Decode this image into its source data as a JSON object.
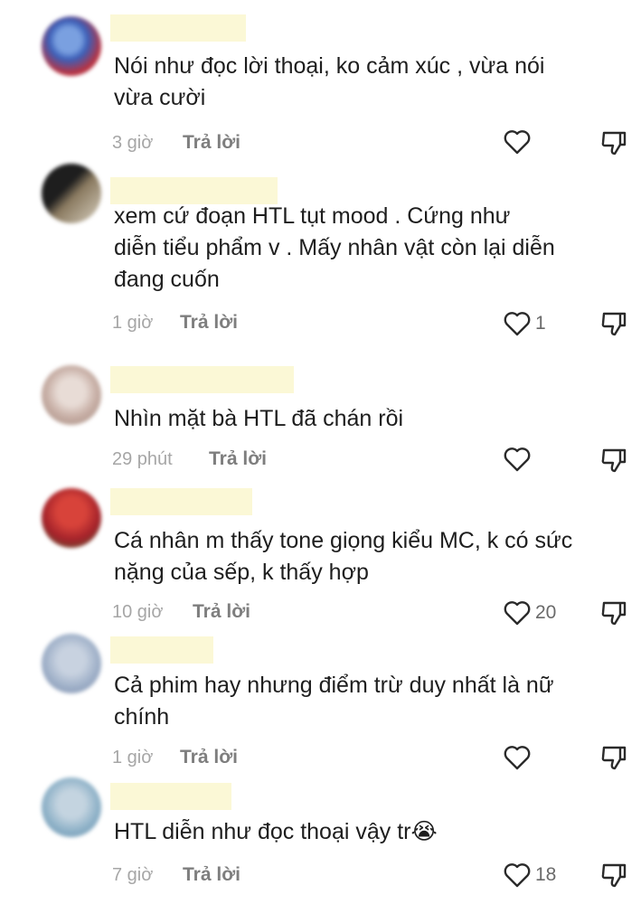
{
  "comments": [
    {
      "text": "Nói như đọc lời thoại, ko cảm xúc , vừa nói\nvừa cười",
      "time": "3 giờ",
      "reply": "Trả lời",
      "likes": "",
      "avatar_colors": [
        "#3b5fb8",
        "#c0303a",
        "#7aa0e0"
      ]
    },
    {
      "text": "  xem cứ đoạn HTL tụt mood      . Cứng như\ndiễn tiểu phẩm v . Mấy nhân vật còn lại diễn\nđang cuốn",
      "time": "1 giờ",
      "reply": "Trả lời",
      "likes": "1",
      "avatar_colors": [
        "#2a2a2a",
        "#8a7a60",
        "#d8d0c0"
      ]
    },
    {
      "text": "Nhìn mặt bà HTL đã chán rồi",
      "time": "29 phút",
      "reply": "Trả lời",
      "likes": "",
      "avatar_colors": [
        "#c9b1a8",
        "#e8dcd6",
        "#a08478"
      ]
    },
    {
      "text": "Cá nhân m thấy tone giọng kiểu MC, k có sức\nnặng của sếp, k thấy hợp",
      "time": "10 giờ",
      "reply": "Trả lời",
      "likes": "20",
      "avatar_colors": [
        "#a4222a",
        "#d8433a",
        "#4a6a3a"
      ]
    },
    {
      "text": "Cả phim hay nhưng điểm trừ duy nhất là nữ\nchính",
      "time": "1 giờ",
      "reply": "Trả lời",
      "likes": "",
      "avatar_colors": [
        "#9fb0c8",
        "#c8d2e0",
        "#7888a8"
      ]
    },
    {
      "text": "HTL diễn như đọc thoại vậy tr😭",
      "time": "7 giờ",
      "reply": "Trả lời",
      "likes": "18",
      "avatar_colors": [
        "#8fb2c8",
        "#5f8aa8",
        "#c4d4e0"
      ]
    }
  ],
  "icons": {
    "like": "heart-outline-icon",
    "dislike": "thumbs-down-outline-icon"
  },
  "colors": {
    "name_redaction": "#fbf8d6",
    "text": "#1e1e1e",
    "meta": "#a6a6a6",
    "reply": "#7e7e7e"
  }
}
